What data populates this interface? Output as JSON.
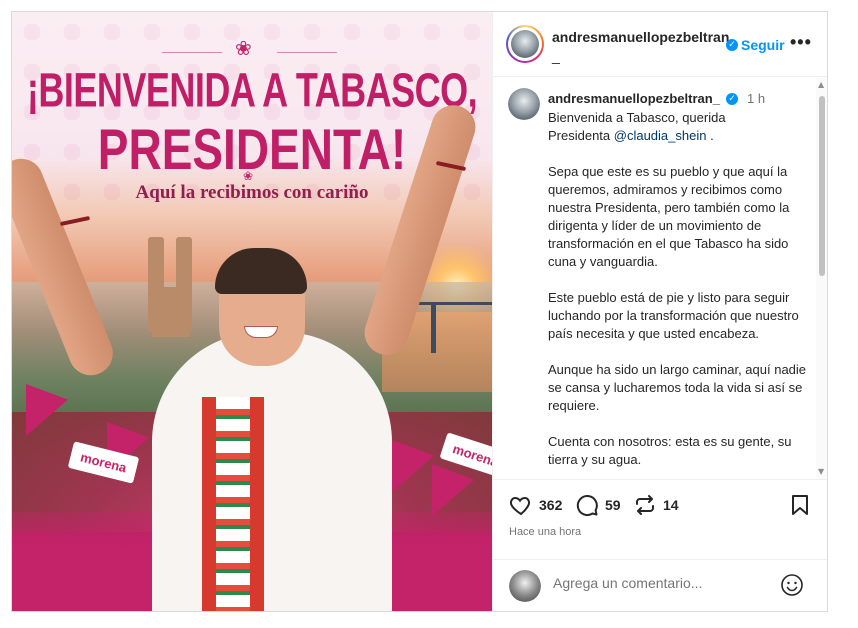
{
  "media": {
    "headline_line1": "¡BIENVENIDA A TABASCO,",
    "headline_line2": "PRESIDENTA!",
    "subline": "Aquí la recibimos con cariño",
    "banner_left": "morena",
    "banner_right": "morena"
  },
  "header": {
    "username_line1": "andresmanuellopezbeltran",
    "username_line2": "_",
    "follow_label": "Seguir",
    "more_label": "•••"
  },
  "caption": {
    "username": "andresmanuellopezbeltran_",
    "time": "1 h",
    "text_prefix": "Bienvenida a Tabasco, querida\nPresidenta ",
    "mention": "@claudia_shein",
    "text_after_mention": " .",
    "body": "\n\nSepa que este es su pueblo y que aquí la queremos, admiramos y recibimos como nuestra Presidenta, pero también como la dirigenta y líder de un movimiento de transformación en el que Tabasco ha sido cuna y vanguardia.\n\nEste pueblo está de pie y listo para seguir luchando por la transformación que nuestro país necesita y que usted encabeza.\n\nAunque ha sido un largo caminar, aquí nadie se cansa y lucharemos toda la vida si así se requiere.\n\nCuenta con nosotros: esta es su gente, su tierra y su agua."
  },
  "actions": {
    "likes": "362",
    "comments": "59",
    "reposts": "14",
    "posted_time": "Hace una hora"
  },
  "comment_box": {
    "placeholder": "Agrega un comentario..."
  },
  "colors": {
    "brand_magenta": "#c4236a",
    "link_blue": "#0095f6",
    "verified_blue": "#0095f6"
  },
  "icons": [
    "lotus-icon",
    "verified-icon",
    "more-icon",
    "heart-icon",
    "comment-icon",
    "repost-icon",
    "bookmark-icon",
    "emoji-icon"
  ]
}
